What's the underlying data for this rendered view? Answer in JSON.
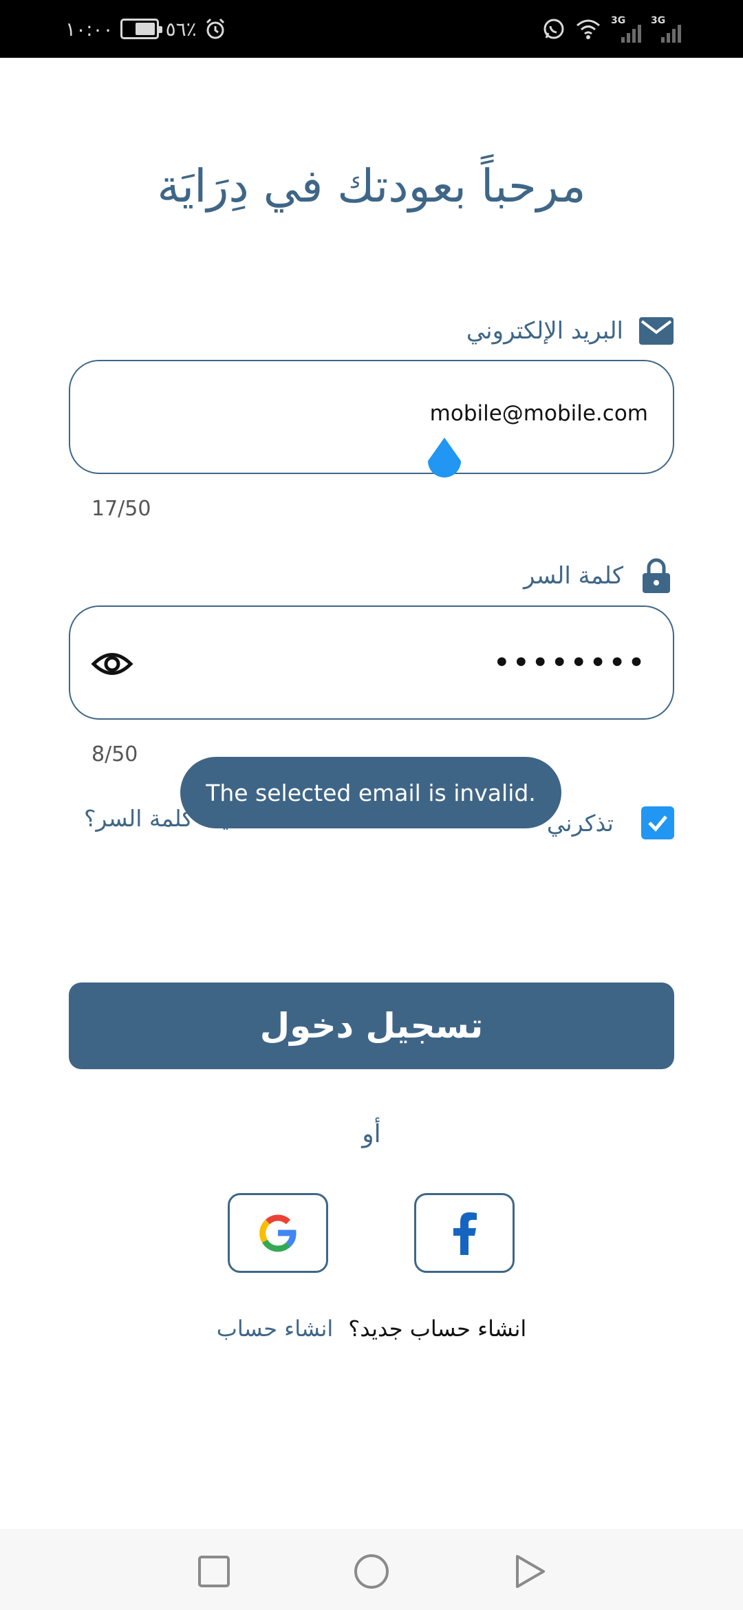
{
  "status_bar": {
    "time": "١٠:٠٠",
    "battery_text": "٥٦٪",
    "network_1": "3G",
    "network_2": "3G"
  },
  "title": "مرحباً بعودتك في دِرَايَة",
  "email": {
    "label": "البريد الإلكتروني",
    "value": "mobile@mobile.com",
    "counter": "17/50"
  },
  "password": {
    "label": "كلمة السر",
    "masked_value": "••••••••",
    "counter": "8/50"
  },
  "remember_me": {
    "label": "تذكرني",
    "checked": true
  },
  "forgot_password": "نسيت كلمة السر؟",
  "toast": "The selected email is invalid.",
  "login_button": "تسجيل دخول",
  "or_text": "أو",
  "signup": {
    "question": "انشاء حساب جديد؟",
    "link": "انشاء حساب"
  },
  "colors": {
    "primary": "#3f6586",
    "accent": "#2196f3",
    "facebook": "#1565c0"
  },
  "icons": [
    "mail-icon",
    "lock-icon",
    "eye-icon",
    "check-icon",
    "google-icon",
    "facebook-icon",
    "alarm-icon",
    "whatsapp-icon",
    "wifi-icon"
  ]
}
